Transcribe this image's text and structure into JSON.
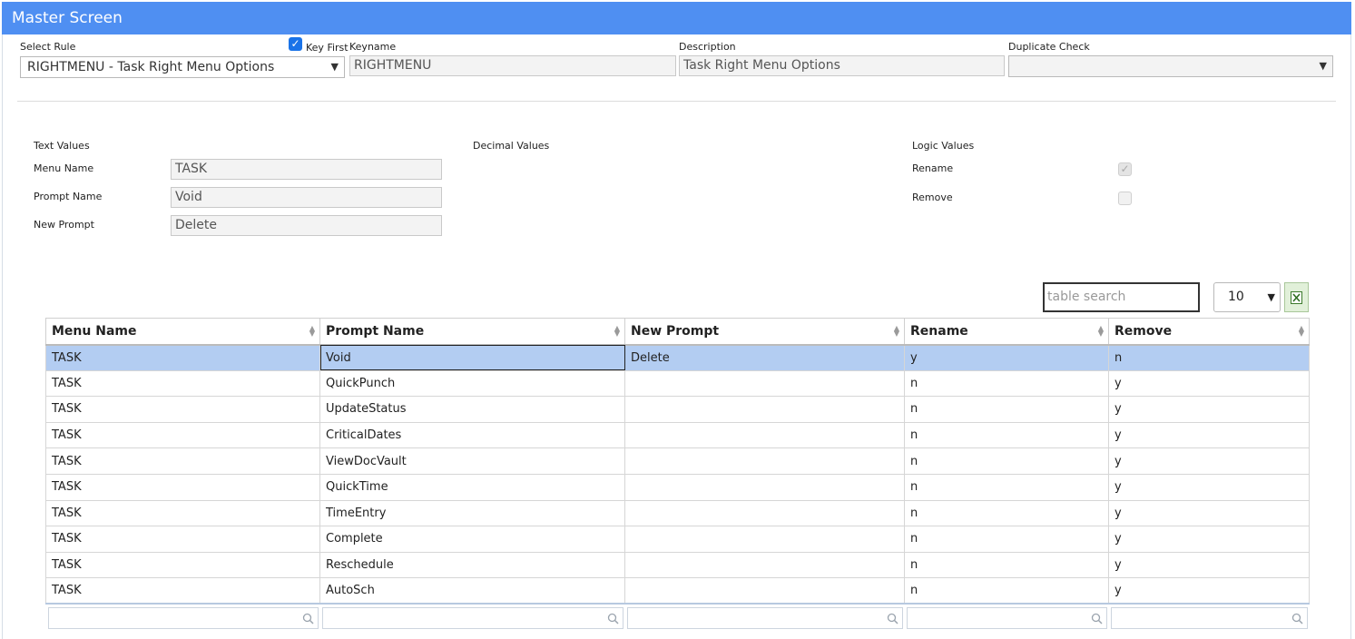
{
  "window": {
    "title": "Master Screen"
  },
  "header": {
    "select_rule": {
      "label": "Select Rule",
      "value": "RIGHTMENU - Task Right Menu Options"
    },
    "key_first": {
      "label": "Key First",
      "checked": true
    },
    "keyname": {
      "label": "Keyname",
      "value": "RIGHTMENU"
    },
    "description": {
      "label": "Description",
      "value": "Task Right Menu Options"
    },
    "duplicate_check": {
      "label": "Duplicate Check",
      "value": ""
    }
  },
  "values": {
    "text_values_heading": "Text Values",
    "decimal_values_heading": "Decimal Values",
    "logic_values_heading": "Logic Values",
    "menu_name": {
      "label": "Menu Name",
      "value": "TASK"
    },
    "prompt_name": {
      "label": "Prompt Name",
      "value": "Void"
    },
    "new_prompt": {
      "label": "New Prompt",
      "value": "Delete"
    },
    "rename": {
      "label": "Rename",
      "checked": true
    },
    "remove": {
      "label": "Remove",
      "checked": false
    }
  },
  "table_tools": {
    "search_placeholder": "table search",
    "page_size": "10",
    "excel_icon": "excel-export-icon"
  },
  "table": {
    "columns": [
      "Menu Name",
      "Prompt Name",
      "New Prompt",
      "Rename",
      "Remove"
    ],
    "rows": [
      [
        "TASK",
        "Void",
        "Delete",
        "y",
        "n"
      ],
      [
        "TASK",
        "QuickPunch",
        "",
        "n",
        "y"
      ],
      [
        "TASK",
        "UpdateStatus",
        "",
        "n",
        "y"
      ],
      [
        "TASK",
        "CriticalDates",
        "",
        "n",
        "y"
      ],
      [
        "TASK",
        "ViewDocVault",
        "",
        "n",
        "y"
      ],
      [
        "TASK",
        "QuickTime",
        "",
        "n",
        "y"
      ],
      [
        "TASK",
        "TimeEntry",
        "",
        "n",
        "y"
      ],
      [
        "TASK",
        "Complete",
        "",
        "n",
        "y"
      ],
      [
        "TASK",
        "Reschedule",
        "",
        "n",
        "y"
      ],
      [
        "TASK",
        "AutoSch",
        "",
        "n",
        "y"
      ]
    ],
    "selected_row": 0
  },
  "colors": {
    "titlebar": "#4f8ff2",
    "selected_row": "#b3cdf2",
    "excel_button": "#e1f0d9"
  }
}
